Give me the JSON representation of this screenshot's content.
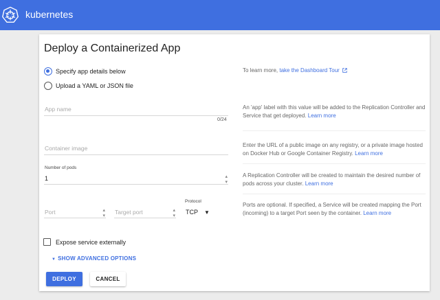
{
  "app": {
    "brand": "kubernetes",
    "accent": "#3f6fe0"
  },
  "page": {
    "title": "Deploy a Containerized App"
  },
  "source": {
    "specify_label": "Specify app details below",
    "upload_label": "Upload a YAML or JSON file",
    "selected": "specify"
  },
  "tour": {
    "prefix": "To learn more, ",
    "link": "take the Dashboard Tour",
    "icon": "external-link-icon"
  },
  "app_name": {
    "placeholder": "App name",
    "value": "",
    "counter": "0/24",
    "help": "An 'app' label with this value will be added to the Replication Controller and Service that get deployed.",
    "learn_more": "Learn more"
  },
  "container_image": {
    "placeholder": "Container image",
    "value": "",
    "help": "Enter the URL of a public image on any registry, or a private image hosted on Docker Hub or Google Container Registry.",
    "learn_more": "Learn more"
  },
  "pods": {
    "label": "Number of pods",
    "value": "1",
    "help": "A Replication Controller will be created to maintain the desired number of pods across your cluster.",
    "learn_more": "Learn more"
  },
  "ports": {
    "port_placeholder": "Port",
    "target_port_placeholder": "Target port",
    "protocol_label": "Protocol",
    "protocol_value": "TCP",
    "help": "Ports are optional. If specified, a Service will be created mapping the Port (incoming) to a target Port seen by the container.",
    "learn_more": "Learn more"
  },
  "expose": {
    "label": "Expose service externally",
    "checked": false
  },
  "advanced": {
    "label": "SHOW ADVANCED OPTIONS"
  },
  "actions": {
    "deploy": "DEPLOY",
    "cancel": "CANCEL"
  }
}
